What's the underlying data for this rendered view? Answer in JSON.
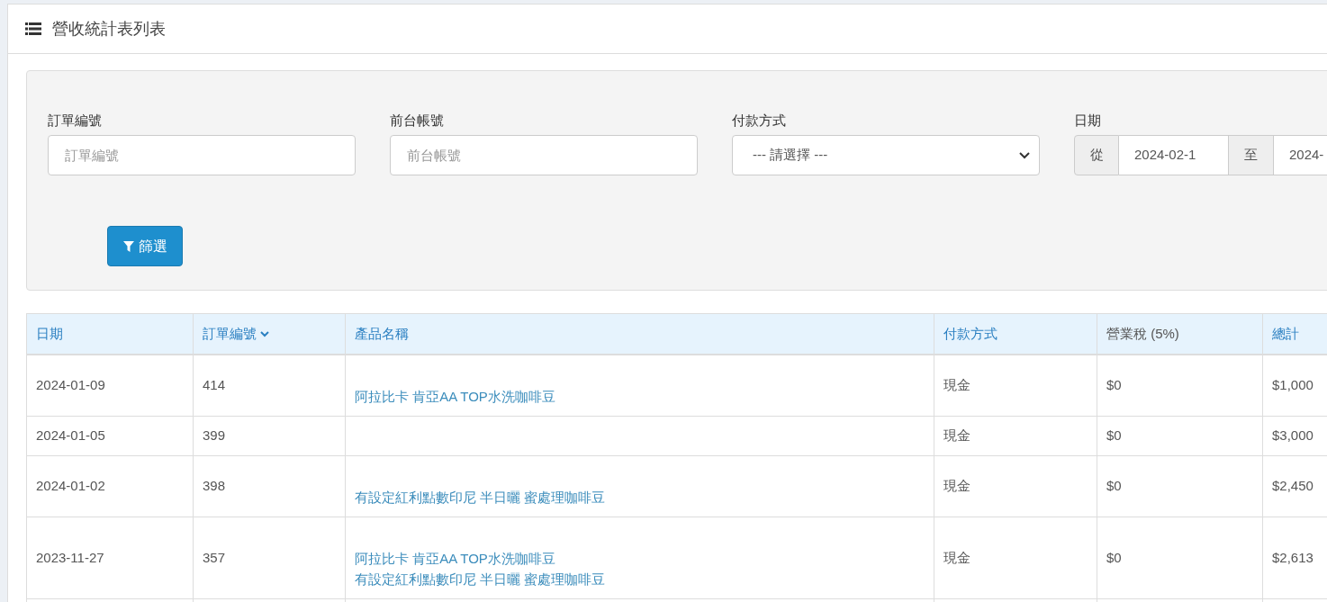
{
  "panel": {
    "title": "營收統計表列表"
  },
  "filters": {
    "fields": [
      {
        "kind": "text",
        "label": "訂單編號",
        "placeholder": "訂單編號"
      },
      {
        "kind": "text",
        "label": "前台帳號",
        "placeholder": "前台帳號"
      },
      {
        "kind": "select",
        "label": "付款方式",
        "value": "--- 請選擇 ---"
      },
      {
        "kind": "daterange",
        "label": "日期",
        "from_label": "從",
        "from_value": "2024-02-1",
        "to_label": "至",
        "to_value": "2024-"
      }
    ],
    "button": "篩選"
  },
  "table": {
    "columns": [
      {
        "label": "日期",
        "sortable": true,
        "sorted": false
      },
      {
        "label": "訂單編號",
        "sortable": true,
        "sorted": true
      },
      {
        "label": "產品名稱",
        "sortable": true,
        "sorted": false
      },
      {
        "label": "付款方式",
        "sortable": true,
        "sorted": false
      },
      {
        "label": "營業稅 (5%)",
        "sortable": false,
        "sorted": false
      },
      {
        "label": "總計",
        "sortable": true,
        "sorted": false
      }
    ],
    "rows": [
      {
        "date": "2024-01-09",
        "order": "414",
        "products": [
          "阿拉比卡 肯亞AA TOP水洗咖啡豆"
        ],
        "payment": "現金",
        "tax": "$0",
        "total": "$1,000"
      },
      {
        "date": "2024-01-05",
        "order": "399",
        "products": [],
        "payment": "現金",
        "tax": "$0",
        "total": "$3,000"
      },
      {
        "date": "2024-01-02",
        "order": "398",
        "products": [
          "有設定紅利點數印尼 半日曬 蜜處理咖啡豆"
        ],
        "payment": "現金",
        "tax": "$0",
        "total": "$2,450"
      },
      {
        "date": "2023-11-27",
        "order": "357",
        "products": [
          "阿拉比卡 肯亞AA TOP水洗咖啡豆",
          "有設定紅利點數印尼 半日曬 蜜處理咖啡豆"
        ],
        "payment": "現金",
        "tax": "$0",
        "total": "$2,613"
      },
      {
        "date": "",
        "order": "",
        "products": [],
        "payment": "",
        "tax": "",
        "total": ""
      }
    ]
  }
}
